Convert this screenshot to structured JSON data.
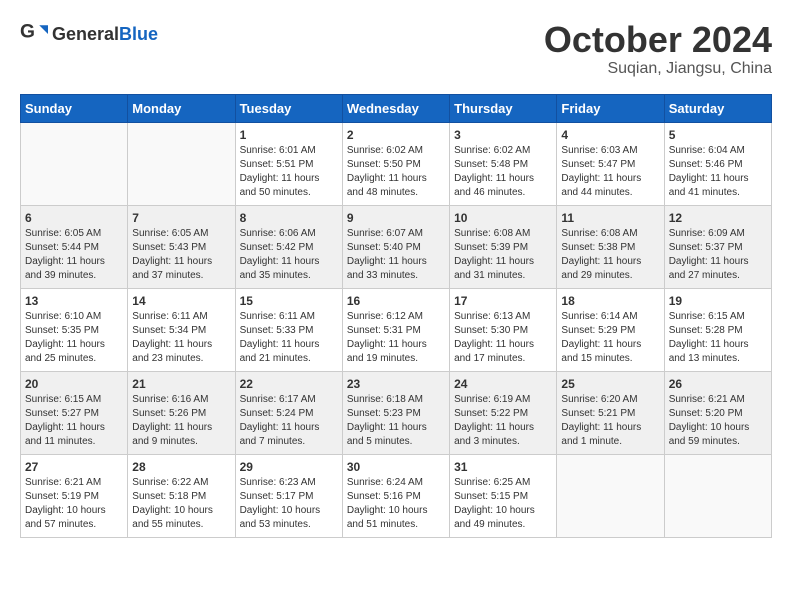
{
  "logo": {
    "general": "General",
    "blue": "Blue"
  },
  "title": {
    "month": "October 2024",
    "location": "Suqian, Jiangsu, China"
  },
  "weekdays": [
    "Sunday",
    "Monday",
    "Tuesday",
    "Wednesday",
    "Thursday",
    "Friday",
    "Saturday"
  ],
  "weeks": [
    [
      {
        "day": "",
        "info": ""
      },
      {
        "day": "",
        "info": ""
      },
      {
        "day": "1",
        "info": "Sunrise: 6:01 AM\nSunset: 5:51 PM\nDaylight: 11 hours and 50 minutes."
      },
      {
        "day": "2",
        "info": "Sunrise: 6:02 AM\nSunset: 5:50 PM\nDaylight: 11 hours and 48 minutes."
      },
      {
        "day": "3",
        "info": "Sunrise: 6:02 AM\nSunset: 5:48 PM\nDaylight: 11 hours and 46 minutes."
      },
      {
        "day": "4",
        "info": "Sunrise: 6:03 AM\nSunset: 5:47 PM\nDaylight: 11 hours and 44 minutes."
      },
      {
        "day": "5",
        "info": "Sunrise: 6:04 AM\nSunset: 5:46 PM\nDaylight: 11 hours and 41 minutes."
      }
    ],
    [
      {
        "day": "6",
        "info": "Sunrise: 6:05 AM\nSunset: 5:44 PM\nDaylight: 11 hours and 39 minutes."
      },
      {
        "day": "7",
        "info": "Sunrise: 6:05 AM\nSunset: 5:43 PM\nDaylight: 11 hours and 37 minutes."
      },
      {
        "day": "8",
        "info": "Sunrise: 6:06 AM\nSunset: 5:42 PM\nDaylight: 11 hours and 35 minutes."
      },
      {
        "day": "9",
        "info": "Sunrise: 6:07 AM\nSunset: 5:40 PM\nDaylight: 11 hours and 33 minutes."
      },
      {
        "day": "10",
        "info": "Sunrise: 6:08 AM\nSunset: 5:39 PM\nDaylight: 11 hours and 31 minutes."
      },
      {
        "day": "11",
        "info": "Sunrise: 6:08 AM\nSunset: 5:38 PM\nDaylight: 11 hours and 29 minutes."
      },
      {
        "day": "12",
        "info": "Sunrise: 6:09 AM\nSunset: 5:37 PM\nDaylight: 11 hours and 27 minutes."
      }
    ],
    [
      {
        "day": "13",
        "info": "Sunrise: 6:10 AM\nSunset: 5:35 PM\nDaylight: 11 hours and 25 minutes."
      },
      {
        "day": "14",
        "info": "Sunrise: 6:11 AM\nSunset: 5:34 PM\nDaylight: 11 hours and 23 minutes."
      },
      {
        "day": "15",
        "info": "Sunrise: 6:11 AM\nSunset: 5:33 PM\nDaylight: 11 hours and 21 minutes."
      },
      {
        "day": "16",
        "info": "Sunrise: 6:12 AM\nSunset: 5:31 PM\nDaylight: 11 hours and 19 minutes."
      },
      {
        "day": "17",
        "info": "Sunrise: 6:13 AM\nSunset: 5:30 PM\nDaylight: 11 hours and 17 minutes."
      },
      {
        "day": "18",
        "info": "Sunrise: 6:14 AM\nSunset: 5:29 PM\nDaylight: 11 hours and 15 minutes."
      },
      {
        "day": "19",
        "info": "Sunrise: 6:15 AM\nSunset: 5:28 PM\nDaylight: 11 hours and 13 minutes."
      }
    ],
    [
      {
        "day": "20",
        "info": "Sunrise: 6:15 AM\nSunset: 5:27 PM\nDaylight: 11 hours and 11 minutes."
      },
      {
        "day": "21",
        "info": "Sunrise: 6:16 AM\nSunset: 5:26 PM\nDaylight: 11 hours and 9 minutes."
      },
      {
        "day": "22",
        "info": "Sunrise: 6:17 AM\nSunset: 5:24 PM\nDaylight: 11 hours and 7 minutes."
      },
      {
        "day": "23",
        "info": "Sunrise: 6:18 AM\nSunset: 5:23 PM\nDaylight: 11 hours and 5 minutes."
      },
      {
        "day": "24",
        "info": "Sunrise: 6:19 AM\nSunset: 5:22 PM\nDaylight: 11 hours and 3 minutes."
      },
      {
        "day": "25",
        "info": "Sunrise: 6:20 AM\nSunset: 5:21 PM\nDaylight: 11 hours and 1 minute."
      },
      {
        "day": "26",
        "info": "Sunrise: 6:21 AM\nSunset: 5:20 PM\nDaylight: 10 hours and 59 minutes."
      }
    ],
    [
      {
        "day": "27",
        "info": "Sunrise: 6:21 AM\nSunset: 5:19 PM\nDaylight: 10 hours and 57 minutes."
      },
      {
        "day": "28",
        "info": "Sunrise: 6:22 AM\nSunset: 5:18 PM\nDaylight: 10 hours and 55 minutes."
      },
      {
        "day": "29",
        "info": "Sunrise: 6:23 AM\nSunset: 5:17 PM\nDaylight: 10 hours and 53 minutes."
      },
      {
        "day": "30",
        "info": "Sunrise: 6:24 AM\nSunset: 5:16 PM\nDaylight: 10 hours and 51 minutes."
      },
      {
        "day": "31",
        "info": "Sunrise: 6:25 AM\nSunset: 5:15 PM\nDaylight: 10 hours and 49 minutes."
      },
      {
        "day": "",
        "info": ""
      },
      {
        "day": "",
        "info": ""
      }
    ]
  ]
}
